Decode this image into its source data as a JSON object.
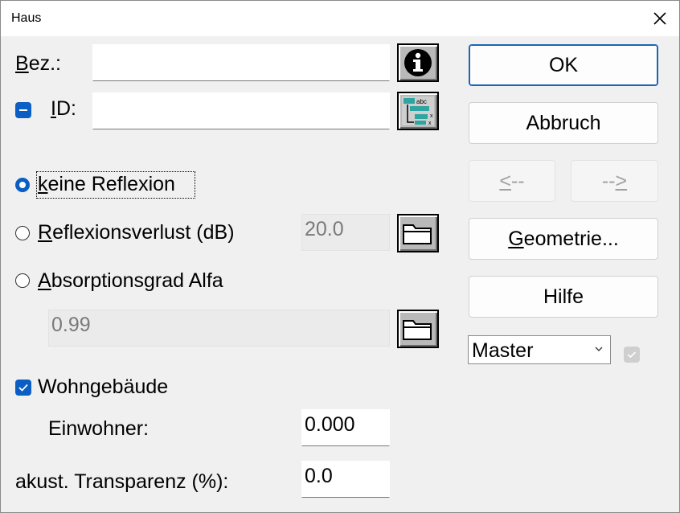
{
  "window": {
    "title": "Haus"
  },
  "form": {
    "bez_label_u": "B",
    "bez_label_rest": "ez.:",
    "bez_value": "",
    "id_label_u": "I",
    "id_label_rest": "D:",
    "id_value": "",
    "radio_keine_u": "k",
    "radio_keine_rest": "eine Reflexion",
    "radio_verlust_u": "R",
    "radio_verlust_rest": "eflexionsverlust (dB)",
    "verlust_value": "20.0",
    "radio_alfa_u": "A",
    "radio_alfa_rest": "bsorptionsgrad Alfa",
    "alfa_value": "0.99",
    "wohngebaeude_label": "Wohngebäude",
    "einwohner_label": "Einwohner:",
    "einwohner_value": "0.000",
    "transparenz_label": "akust. Transparenz (%):",
    "transparenz_value": "0.0"
  },
  "buttons": {
    "ok": "OK",
    "abbruch": "Abbruch",
    "prev_u": "<",
    "prev_rest": "--",
    "next_rest": "--",
    "next_u": ">",
    "geometrie_u": "G",
    "geometrie_rest": "eometrie...",
    "hilfe": "Hilfe"
  },
  "select": {
    "value": "Master"
  },
  "icons": {
    "info": "info-icon",
    "tree": "tree-list-icon",
    "folder": "folder-icon",
    "close": "close-icon"
  },
  "colors": {
    "accent": "#0a5ec4",
    "default_border": "#1a66b3"
  }
}
